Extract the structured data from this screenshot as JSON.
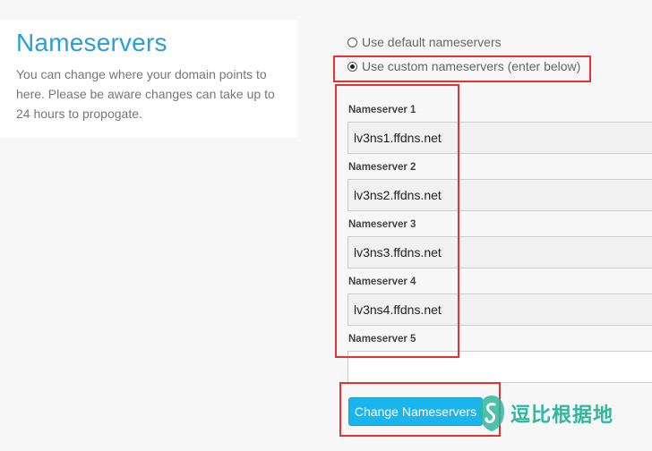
{
  "info": {
    "title": "Nameservers",
    "description": "You can change where your domain points to here. Please be aware changes can take up to 24 hours to propogate."
  },
  "options": [
    {
      "label": "Use default nameservers",
      "selected": false
    },
    {
      "label": "Use custom nameservers (enter below)",
      "selected": true
    }
  ],
  "nameservers": [
    {
      "label": "Nameserver 1",
      "value": "lv3ns1.ffdns.net"
    },
    {
      "label": "Nameserver 2",
      "value": "lv3ns2.ffdns.net"
    },
    {
      "label": "Nameserver 3",
      "value": "lv3ns3.ffdns.net"
    },
    {
      "label": "Nameserver 4",
      "value": "lv3ns4.ffdns.net"
    },
    {
      "label": "Nameserver 5",
      "value": ""
    }
  ],
  "submit_label": "Change Nameservers",
  "watermark": {
    "text": "逗比根据地"
  },
  "colors": {
    "accent": "#2a9fd6",
    "button": "#19b5ec",
    "highlight": "#e53333",
    "watermark": "#2fb89c"
  }
}
